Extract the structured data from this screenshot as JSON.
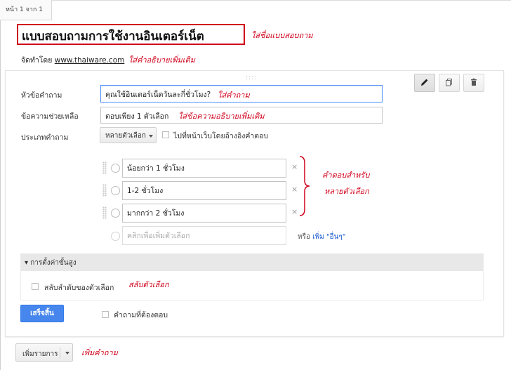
{
  "page_indicator": "หน้า 1 จาก 1",
  "form_title": "แบบสอบถามการใช้งานอินเตอร์เน็ต",
  "byline": {
    "prefix": "จัดทำโดย ",
    "link": "www.thaiware.com"
  },
  "notes": {
    "title": "ใส่ชื่อแบบสอบถาม",
    "description": "ใส่คำอธิบายเพิ่มเติม",
    "question": "ใส่คำถาม",
    "help": "ใส่ข้อความอธิบายเพิ่มเติม",
    "choices_line1": "คำตอบสำหรับ",
    "choices_line2": "หลายตัวเลือก",
    "shuffle": "สลับตัวเลือก",
    "add_item": "เพิ่มคำถาม"
  },
  "editor": {
    "drag_handle": "::::",
    "question_title_label": "หัวข้อคำถาม",
    "question_title_value": "คุณใช้อินเตอร์เน็ตวันละกี่ชั่วโมง?",
    "help_text_label": "ข้อความช่วยเหลือ",
    "help_text_value": "ตอบเพียง 1 ตัวเลือก",
    "question_type_label": "ประเภทคำถาม",
    "question_type_value": "หลายตัวเลือก",
    "go_to_page_label": "ไปที่หน้าเว็บโดยอ้างอิงคำตอบ",
    "options": [
      {
        "label": "น้อยกว่า 1 ชั่วโมง"
      },
      {
        "label": "1-2 ชั่วโมง"
      },
      {
        "label": "มากกว่า 2 ชั่วโมง"
      }
    ],
    "remove_mark": "×",
    "add_option_placeholder": "คลิกเพื่อเพิ่มตัวเลือก",
    "or_text": "หรือ",
    "add_text": "เพิ่ม",
    "other_link": "\"อื่นๆ\"",
    "advanced_settings": "▾ การตั้งค่าขั้นสูง",
    "shuffle_label": "สลับลำดับของตัวเลือก",
    "done_button": "เสร็จสิ้น",
    "required_label": "คำถามที่ต้องตอบ"
  },
  "add_item_button": "เพิ่มรายการ",
  "colors": {
    "annotation_red": "#d0021b",
    "primary_blue": "#4787ed",
    "focus_blue": "#4d90fe",
    "link_blue": "#1155cc"
  }
}
